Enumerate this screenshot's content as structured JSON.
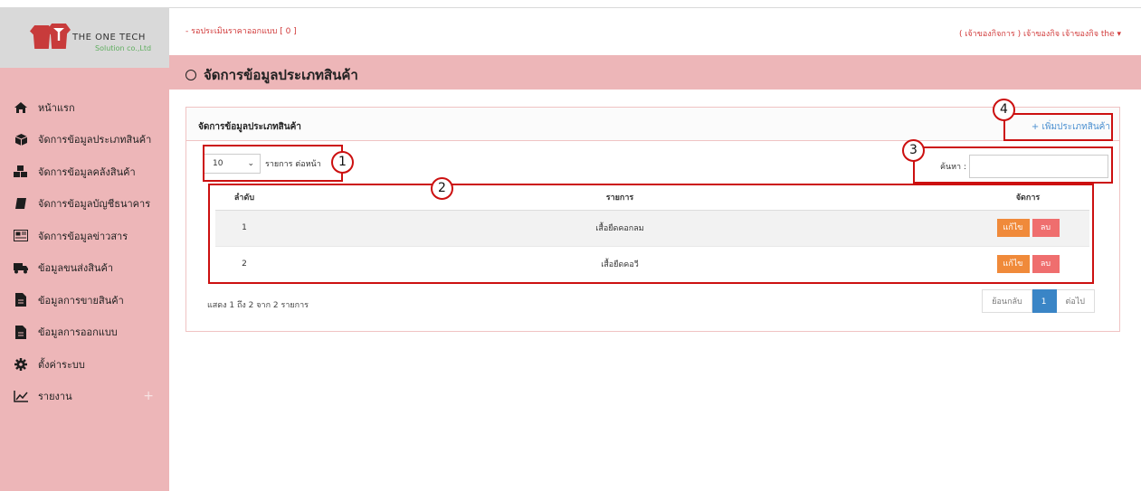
{
  "brand": {
    "name": "THE ONE TECH",
    "sub": "Solution co.,Ltd"
  },
  "header": {
    "notice": "- รอประเมินราคาออกแบบ [ 0 ]",
    "user": "( เจ้าของกิจการ ) เจ้าของกิจ เจ้าของกิจ the ▾"
  },
  "page_title": "จัดการข้อมูลประเภทสินค้า",
  "sidebar": {
    "items": [
      {
        "label": "หน้าแรก",
        "icon": "home-icon"
      },
      {
        "label": "จัดการข้อมูลประเภทสินค้า",
        "icon": "box-icon"
      },
      {
        "label": "จัดการข้อมูลคลังสินค้า",
        "icon": "cubes-icon"
      },
      {
        "label": "จัดการข้อมูลบัญชีธนาคาร",
        "icon": "book-icon"
      },
      {
        "label": "จัดการข้อมูลข่าวสาร",
        "icon": "newspaper-icon"
      },
      {
        "label": "ข้อมูลขนส่งสินค้า",
        "icon": "truck-icon"
      },
      {
        "label": "ข้อมูลการขายสินค้า",
        "icon": "file-icon"
      },
      {
        "label": "ข้อมูลการออกแบบ",
        "icon": "file-icon"
      },
      {
        "label": "ตั้งค่าระบบ",
        "icon": "gear-icon"
      },
      {
        "label": "รายงาน",
        "icon": "chart-icon",
        "expand": "+"
      }
    ]
  },
  "panel": {
    "title": "จัดการข้อมูลประเภทสินค้า",
    "add_label": "+ เพิ่มประเภทสินค้า",
    "page_length": "10",
    "length_label": "รายการ ต่อหน้า",
    "search_label": "ค้นหา :",
    "search_value": "",
    "columns": [
      "ลำดับ",
      "รายการ",
      "จัดการ"
    ],
    "rows": [
      {
        "no": "1",
        "name": "เสื้อยืดคอกลม"
      },
      {
        "no": "2",
        "name": "เสื้อยืดคอวี"
      }
    ],
    "edit_label": "แก้ไข",
    "delete_label": "ลบ",
    "info": "แสดง 1 ถึง 2 จาก 2 รายการ",
    "pager": {
      "prev": "ย้อนกลับ",
      "current": "1",
      "next": "ต่อไป"
    }
  },
  "annotations": [
    "1",
    "2",
    "3",
    "4"
  ],
  "colors": {
    "sidebar_bg": "#edb6b8",
    "accent_red": "#cc1010",
    "link_blue": "#4a8fd0",
    "edit": "#f08a3a",
    "delete": "#ef6e6e",
    "pager_active": "#3a85c6"
  }
}
